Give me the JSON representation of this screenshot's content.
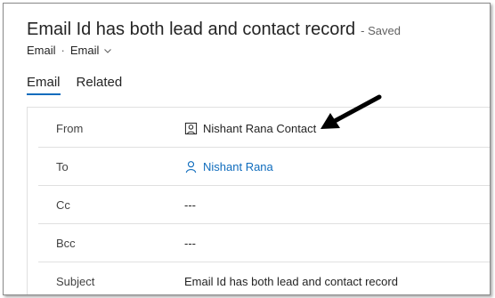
{
  "header": {
    "title": "Email Id has both lead and contact record",
    "status": "- Saved",
    "entity": "Email",
    "separator": "·",
    "form_selector": "Email"
  },
  "tabs": [
    {
      "label": "Email",
      "active": true
    },
    {
      "label": "Related",
      "active": false
    }
  ],
  "fields": {
    "from": {
      "label": "From",
      "value": "Nishant Rana Contact",
      "icon": "contact-card-icon"
    },
    "to": {
      "label": "To",
      "value": "Nishant Rana",
      "icon": "person-icon"
    },
    "cc": {
      "label": "Cc",
      "value": "---"
    },
    "bcc": {
      "label": "Bcc",
      "value": "---"
    },
    "subject": {
      "label": "Subject",
      "value": "Email Id has both lead and contact record"
    }
  },
  "colors": {
    "accent": "#0f6cbd",
    "text": "#242424",
    "border": "#e0e0e0"
  }
}
